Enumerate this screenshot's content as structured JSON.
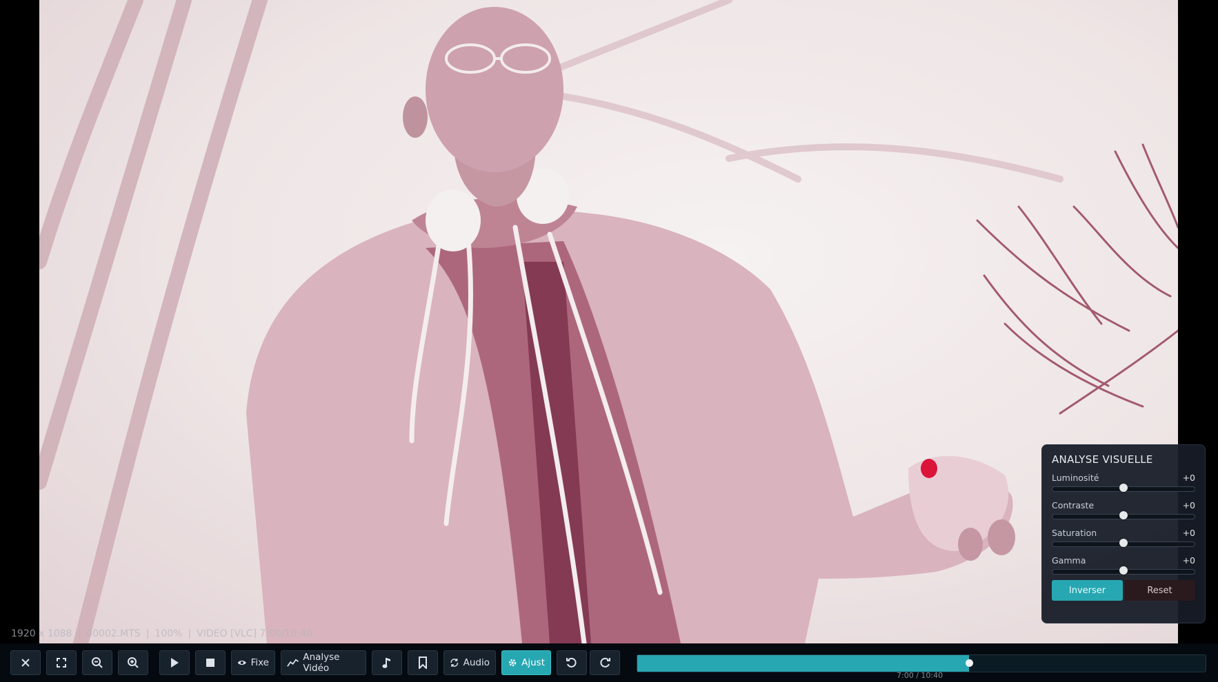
{
  "status": {
    "resolution": "1920 x 1088",
    "file": "00002.MTS",
    "zoom": "100%",
    "mode": "VIDEO [VLC] 7:00/10:40"
  },
  "panel": {
    "title": "ANALYSE VISUELLE",
    "params": [
      {
        "label": "Luminosité",
        "value": "+0",
        "level": 0.5
      },
      {
        "label": "Contraste",
        "value": "+0",
        "level": 0.5
      },
      {
        "label": "Saturation",
        "value": "+0",
        "level": 0.5
      },
      {
        "label": "Gamma",
        "value": "+0",
        "level": 0.5
      }
    ],
    "invert_label": "Inverser",
    "reset_label": "Reset"
  },
  "toolbar": {
    "fixe_label": "Fixe",
    "analyse_label": "Analyse Vidéo",
    "audio_label": "Audio",
    "ajust_label": "Ajust",
    "icons": [
      "close-icon",
      "fullscreen-icon",
      "zoom-out-icon",
      "zoom-in-icon",
      "play-icon",
      "stop-icon",
      "eye-icon",
      "chart-icon",
      "music-note-icon",
      "bookmark-icon",
      "sync-icon",
      "gear-icon",
      "rotate-left-icon",
      "rotate-right-icon"
    ]
  },
  "playback": {
    "time": "7:00 / 10:40",
    "progress": 0.5833
  },
  "colors": {
    "accent": "#27a7b1",
    "tint": "#8c3a52"
  }
}
